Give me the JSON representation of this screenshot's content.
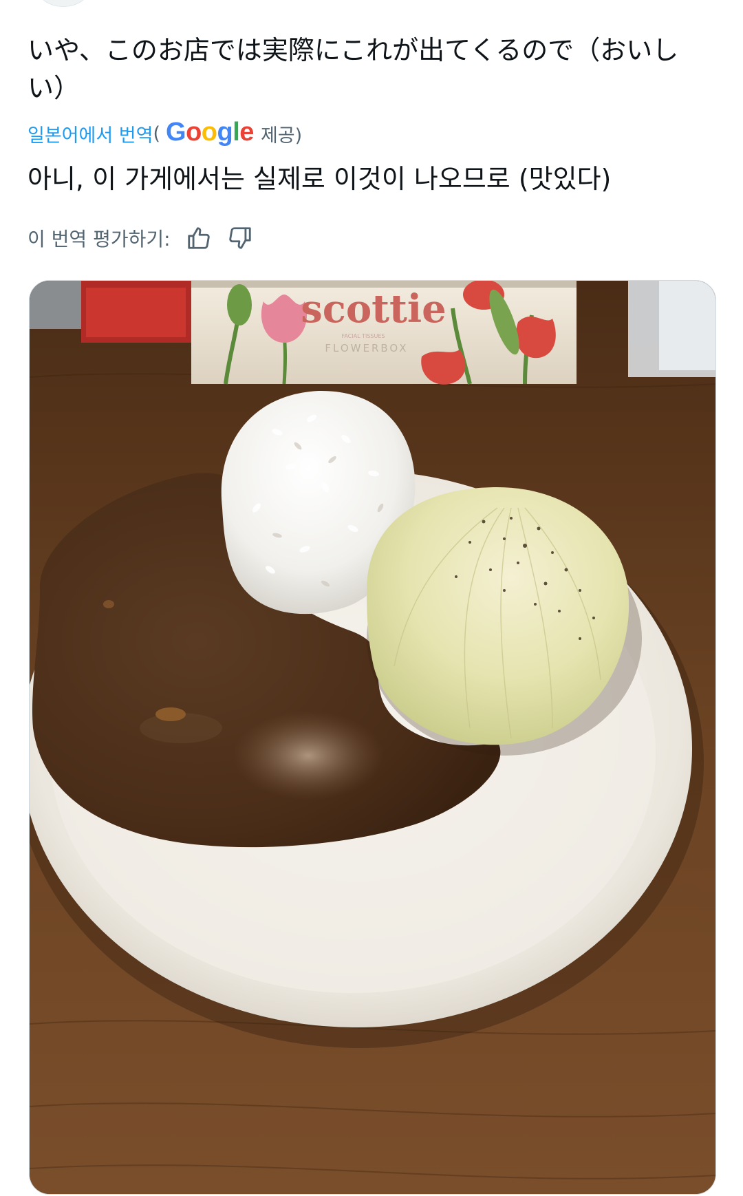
{
  "post": {
    "original_text": "いや、このお店では実際にこれが出てくるので（おいしい）",
    "translation_link": "일본어에서 번역",
    "translation_paren_open": "(",
    "google_logo": "Google",
    "translation_provider_suffix": "제공)",
    "translated_text": "아니, 이 가게에서는 실제로 이것이 나오므로 (맛있다)",
    "rate_label": "이 번역 평가하기:"
  },
  "icons": {
    "thumbs_up": "thumbs-up-icon",
    "thumbs_down": "thumbs-down-icon"
  },
  "photo": {
    "tissue_brand": "scottie",
    "tissue_product": "FLOWERBOX",
    "tissue_tiny_text": "FACIAL TISSUES"
  },
  "colors": {
    "link": "#1d9bf0",
    "secondary_text": "#536471",
    "primary_text": "#0f1419",
    "google_blue": "#4285F4",
    "google_red": "#EA4335",
    "google_yellow": "#FBBC05",
    "google_green": "#34A853"
  }
}
